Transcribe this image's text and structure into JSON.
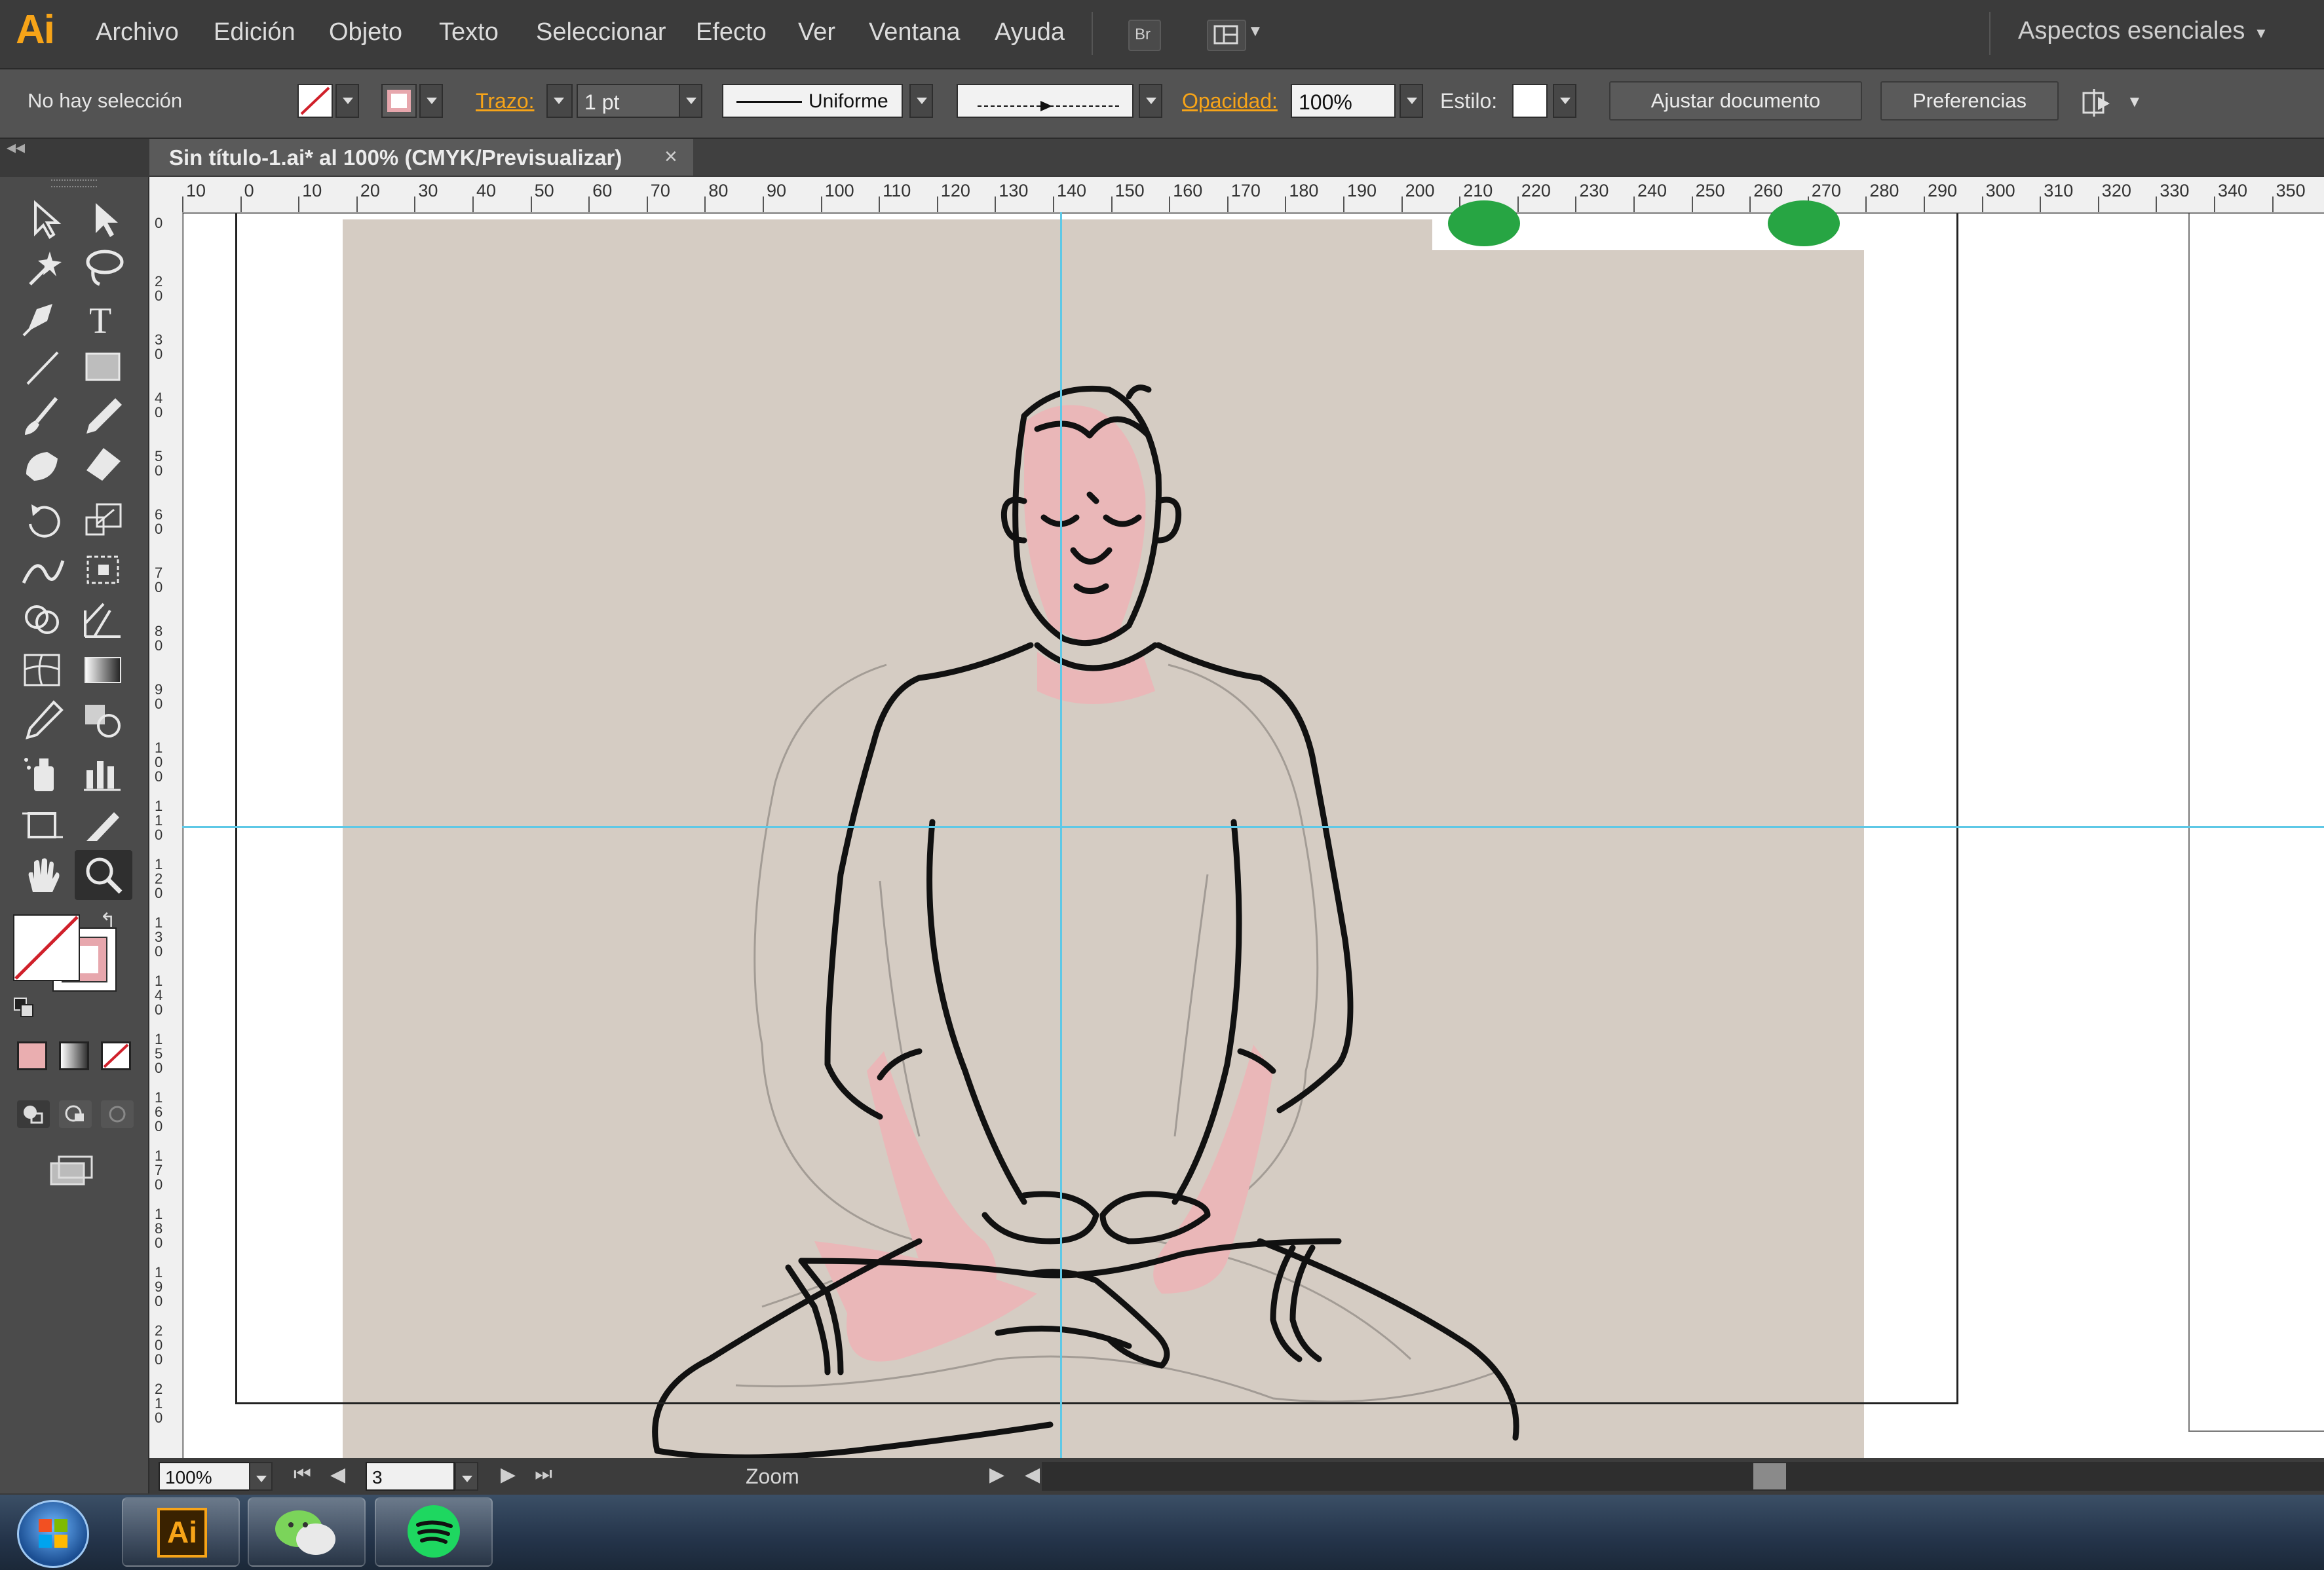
{
  "app": {
    "logo": "Ai"
  },
  "menu": [
    "Archivo",
    "Edición",
    "Objeto",
    "Texto",
    "Seleccionar",
    "Efecto",
    "Ver",
    "Ventana",
    "Ayuda"
  ],
  "bridge_label": "Br",
  "workspace": "Aspectos esenciales",
  "control_bar": {
    "selection_status": "No hay selección",
    "stroke_label": "Trazo:",
    "stroke_weight": "1 pt",
    "stroke_profile": "Uniforme",
    "opacity_label": "Opacidad:",
    "opacity_value": "100%",
    "style_label": "Estilo:",
    "adjust_document": "Ajustar documento",
    "preferences": "Preferencias"
  },
  "document_tab": {
    "title": "Sin título-1.ai* al 100% (CMYK/Previsualizar)",
    "close": "×"
  },
  "ruler": {
    "horizontal": [
      "10",
      "0",
      "10",
      "20",
      "30",
      "40",
      "50",
      "60",
      "70",
      "80",
      "90",
      "100",
      "110",
      "120",
      "130",
      "140",
      "150",
      "160",
      "170",
      "180",
      "190",
      "200",
      "210",
      "220",
      "230",
      "240",
      "250",
      "260",
      "270",
      "280",
      "290",
      "300",
      "310",
      "320",
      "330",
      "340",
      "350"
    ],
    "vertical": [
      "0",
      "20",
      "30",
      "40",
      "50",
      "60",
      "70",
      "80",
      "90",
      "100",
      "110",
      "120",
      "130",
      "140",
      "150",
      "160",
      "170",
      "180",
      "190",
      "200",
      "210"
    ]
  },
  "status_bar": {
    "zoom_value": "100%",
    "artboard_number": "3",
    "status_label": "Zoom"
  },
  "colors": {
    "accent": "#f7a418",
    "guide": "#5ec8e6",
    "skin": "#eab7b8",
    "paper": "#d5ccc3",
    "panel": "#4b4b4b"
  },
  "taskbar": [
    "windows-start",
    "illustrator",
    "wechat",
    "spotify"
  ]
}
